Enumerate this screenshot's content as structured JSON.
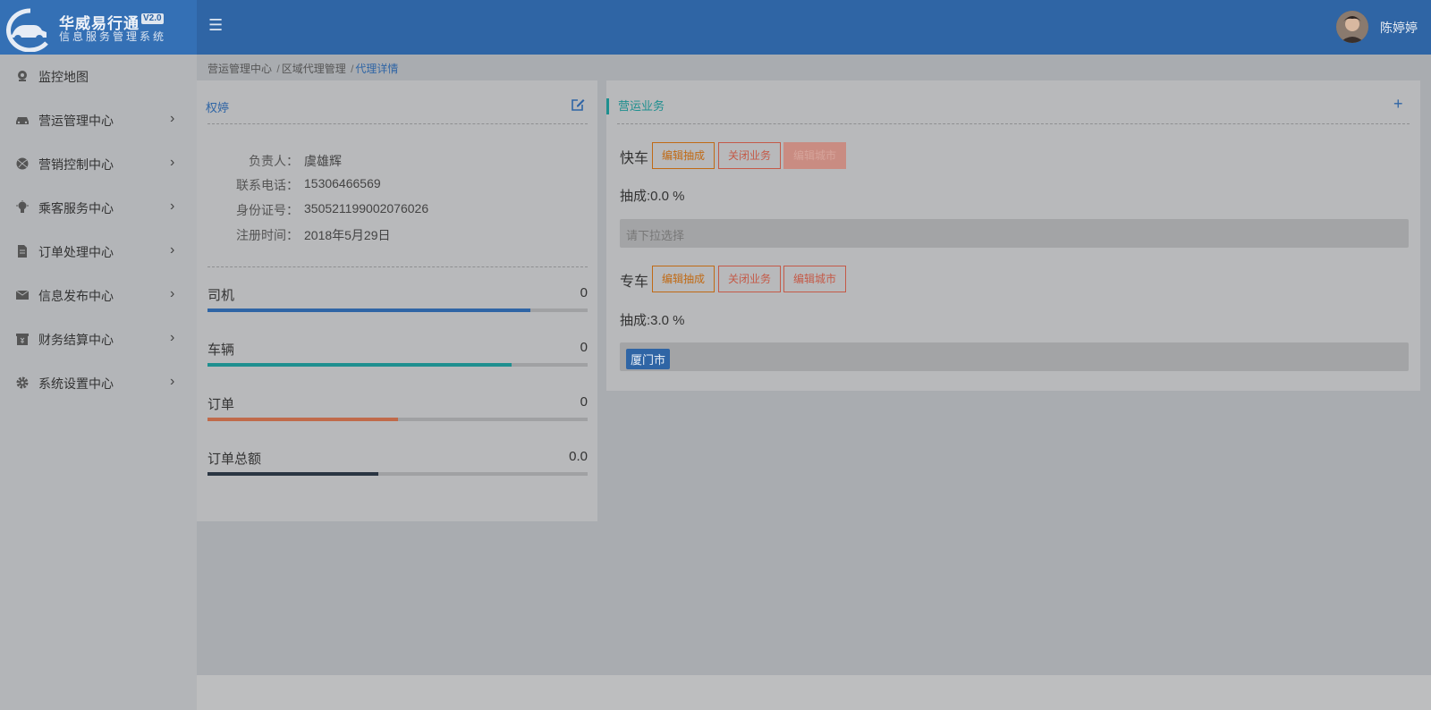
{
  "app": {
    "title": "华威易行通",
    "version": "V2.0",
    "subtitle": "信息服务管理系统"
  },
  "header": {
    "menu_icon": "hamburger-icon",
    "user_name": "陈婷婷"
  },
  "sidebar": {
    "items": [
      {
        "label": "监控地图",
        "icon": "map-camera-icon"
      },
      {
        "label": "营运管理中心",
        "icon": "car-icon"
      },
      {
        "label": "营销控制中心",
        "icon": "ball-icon"
      },
      {
        "label": "乘客服务中心",
        "icon": "lightbulb-icon"
      },
      {
        "label": "订单处理中心",
        "icon": "document-icon"
      },
      {
        "label": "信息发布中心",
        "icon": "envelope-icon"
      },
      {
        "label": "财务结算中心",
        "icon": "money-box-icon"
      },
      {
        "label": "系统设置中心",
        "icon": "gear-icon"
      }
    ]
  },
  "breadcrumb": {
    "items": [
      "营运管理中心",
      "区域代理管理"
    ],
    "current": "代理详情",
    "separator": "/"
  },
  "agent": {
    "name": "权婷",
    "info": [
      {
        "key": "负责人：",
        "value": "虞雄辉"
      },
      {
        "key": "联系电话：",
        "value": "15306466569"
      },
      {
        "key": "身份证号：",
        "value": "350521199002076026"
      },
      {
        "key": "注册时间：",
        "value": "2018年5月29日"
      }
    ],
    "stats": [
      {
        "label": "司机",
        "value": "0",
        "fill": 0.85,
        "color": "#2f65a5"
      },
      {
        "label": "车辆",
        "value": "0",
        "fill": 0.8,
        "color": "#1e8f8f"
      },
      {
        "label": "订单",
        "value": "0",
        "fill": 0.5,
        "color": "#c06a4a"
      },
      {
        "label": "订单总额",
        "value": "0.0",
        "fill": 0.45,
        "color": "#2a3542"
      }
    ]
  },
  "business": {
    "title": "营运业务",
    "services": [
      {
        "name": "快车",
        "buttons": [
          "编辑抽成",
          "关闭业务",
          "编辑城市"
        ],
        "rate": "抽成:0.0 %",
        "placeholder": "请下拉选择",
        "cities": []
      },
      {
        "name": "专车",
        "buttons": [
          "编辑抽成",
          "关闭业务",
          "编辑城市"
        ],
        "rate": "抽成:3.0 %",
        "placeholder": "",
        "cities": [
          "厦门市"
        ]
      }
    ]
  }
}
